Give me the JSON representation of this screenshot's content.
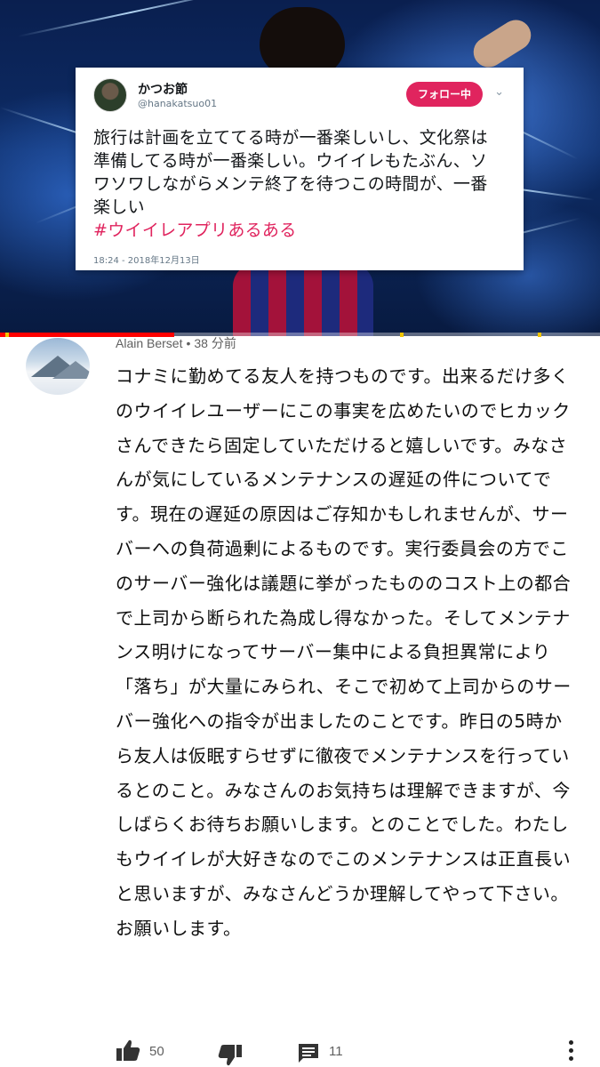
{
  "video": {
    "tweet": {
      "display_name": "かつお節",
      "handle": "@hanakatsuo01",
      "follow_label": "フォロー中",
      "body": "旅行は計画を立ててる時が一番楽しいし、文化祭は準備してる時が一番楽しい。ウイイレもたぶん、ソワソワしながらメンテ終了を待つこの時間が、一番楽しい",
      "hashtag": "#ウイイレアプリあるある",
      "timestamp": "18:24 - 2018年12月13日"
    },
    "progress_fraction": 0.29,
    "colors": {
      "progress": "#ff0000",
      "hashtag": "#e0245e",
      "follow_button": "#e0245e"
    }
  },
  "comment": {
    "author": "Alain Berset",
    "separator": "•",
    "time": "38 分前",
    "text": "コナミに勤めてる友人を持つものです。出来るだけ多くのウイイレユーザーにこの事実を広めたいのでヒカックさんできたら固定していただけると嬉しいです。みなさんが気にしているメンテナンスの遅延の件についてです。現在の遅延の原因はご存知かもしれませんが、サーバーへの負荷過剰によるものです。実行委員会の方でこのサーバー強化は議題に挙がったもののコスト上の都合で上司から断られた為成し得なかった。そしてメンテナンス明けになってサーバー集中による負担異常により「落ち」が大量にみられ、そこで初めて上司からのサーバー強化への指令が出ましたのことです。昨日の5時から友人は仮眠すらせずに徹夜でメンテナンスを行っているとのこと。みなさんのお気持ちは理解できますが、今しばらくお待ちお願いします。とのことでした。わたしもウイイレが大好きなのでこのメンテナンスは正直長いと思いますが、みなさんどうか理解してやって下さい。お願いします。",
    "likes": "50",
    "replies": "11",
    "icons": [
      "thumbs-up-icon",
      "thumbs-down-icon",
      "reply-icon",
      "more-options-icon"
    ]
  }
}
